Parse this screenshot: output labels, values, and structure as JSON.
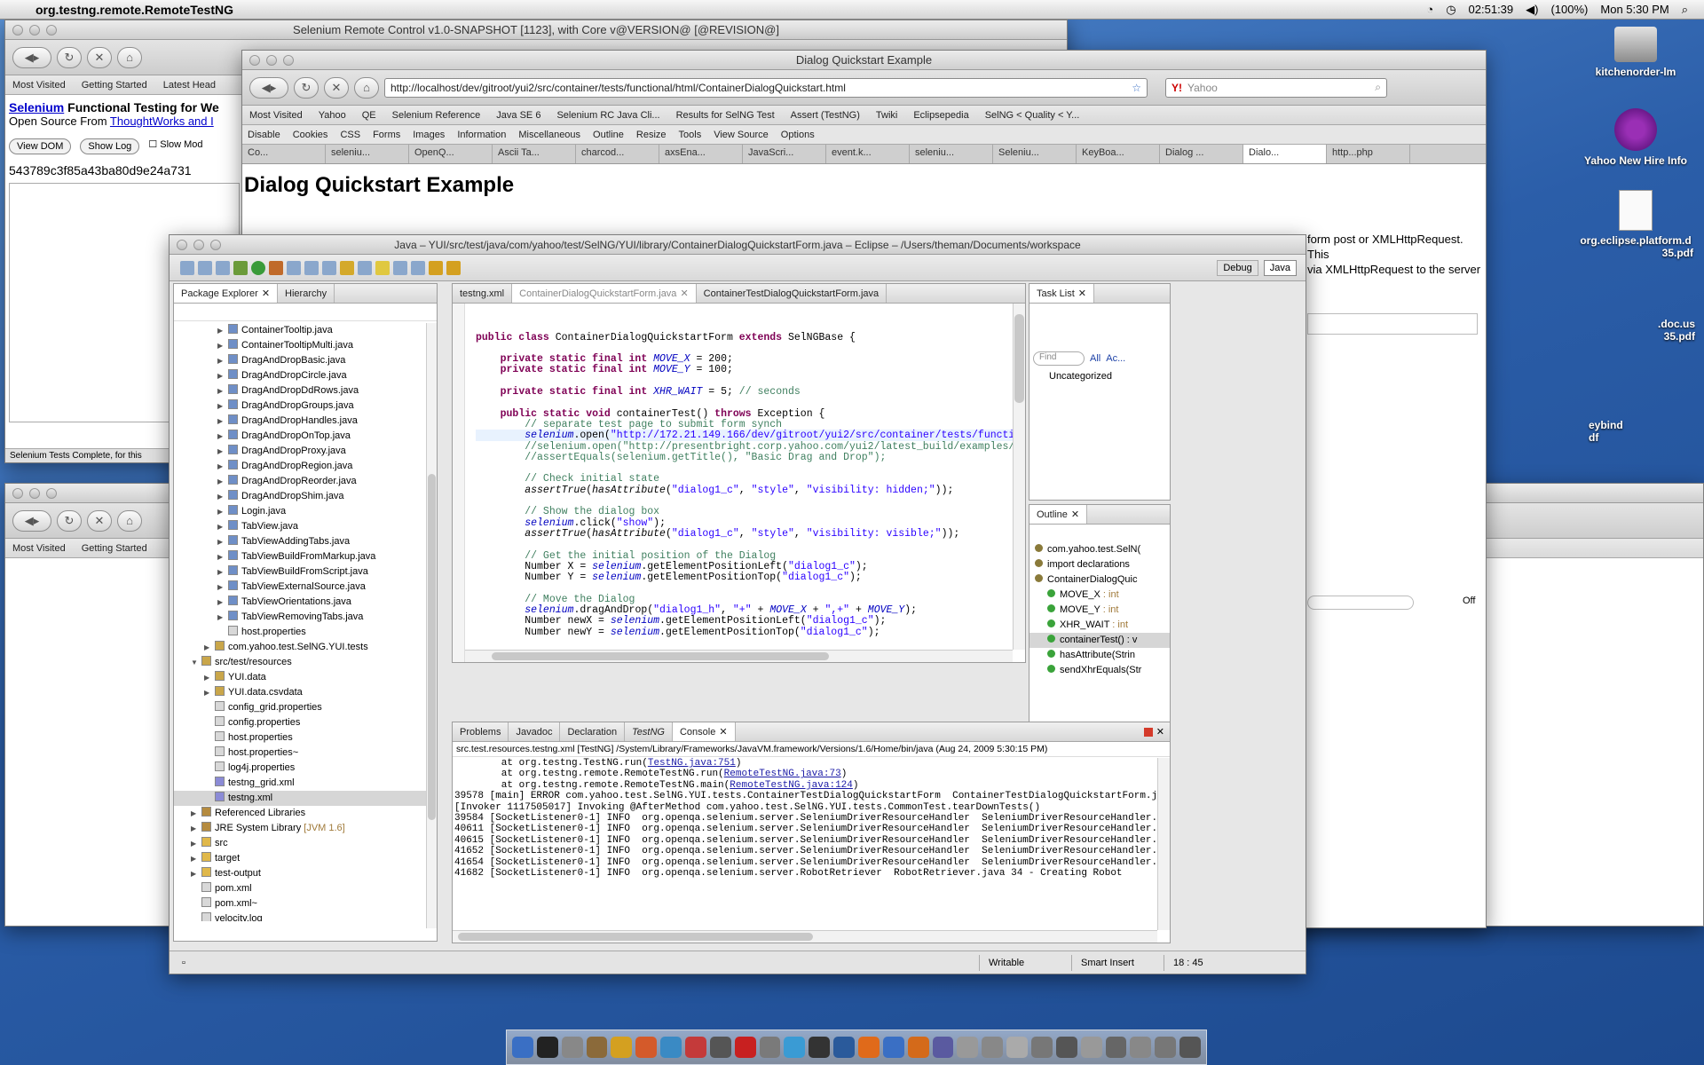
{
  "menubar": {
    "app": "org.testng.remote.RemoteTestNG",
    "time": "02:51:39",
    "battery": "(100%)",
    "clock": "Mon 5:30 PM"
  },
  "desktop": {
    "icons": [
      "kitchenorder-lm",
      "Yahoo New Hire Info",
      "org.eclipse.platform.d",
      "35.pdf",
      ".doc.us",
      "35.pdf",
      "eybind",
      "df"
    ]
  },
  "selenium_window": {
    "title": "Selenium Remote Control v1.0-SNAPSHOT [1123], with Core v@VERSION@ [@REVISION@]",
    "bookmarks": [
      "Most Visited",
      "Getting Started",
      "Latest Head"
    ],
    "heading_link": "Selenium",
    "heading_rest": " Functional Testing for We",
    "subtitle": "Open Source From ",
    "subtitle_link": "ThoughtWorks and I",
    "buttons": {
      "view_dom": "View DOM",
      "show_log": "Show Log",
      "slow_mode": "Slow Mod"
    },
    "session": "543789c3f85a43ba80d9e24a731",
    "status": "Selenium Tests Complete, for this"
  },
  "second_window": {
    "bookmarks": [
      "Most Visited",
      "Getting Started"
    ]
  },
  "firefox": {
    "title": "Dialog Quickstart Example",
    "url": "http://localhost/dev/gitroot/yui2/src/container/tests/functional/html/ContainerDialogQuickstart.html",
    "search": "Yahoo",
    "bookmarks": [
      "Most Visited",
      "Yahoo",
      "QE",
      "Selenium Reference",
      "Java SE 6",
      "Selenium RC Java Cli...",
      "Results for SelNG Test",
      "Assert (TestNG)",
      "Twiki",
      "Eclipsepedia",
      "SelNG < Quality < Y..."
    ],
    "webdev": [
      "Disable",
      "Cookies",
      "CSS",
      "Forms",
      "Images",
      "Information",
      "Miscellaneous",
      "Outline",
      "Resize",
      "Tools",
      "View Source",
      "Options"
    ],
    "tabs": [
      "Co...",
      "seleniu...",
      "OpenQ...",
      "Ascii Ta...",
      "charcod...",
      "axsEna...",
      "JavaScri...",
      "event.k...",
      "seleniu...",
      "Seleniu...",
      "KeyBoa...",
      "Dialog ...",
      "Dialo...",
      "http...php"
    ],
    "page_heading": "Dialog Quickstart Example",
    "page_text_1": "form post or XMLHttpRequest. This",
    "page_text_2": "via XMLHttpRequest to the server",
    "off": "Off"
  },
  "eclipse": {
    "title": "Java – YUI/src/test/java/com/yahoo/test/SelNG/YUI/library/ContainerDialogQuickstartForm.java – Eclipse – /Users/theman/Documents/workspace",
    "perspectives": [
      "Debug",
      "Java"
    ],
    "explorer_tabs": [
      "Package Explorer",
      "Hierarchy"
    ],
    "tree": [
      {
        "t": "ContainerTooltip.java",
        "d": 3,
        "ic": "j"
      },
      {
        "t": "ContainerTooltipMulti.java",
        "d": 3,
        "ic": "j"
      },
      {
        "t": "DragAndDropBasic.java",
        "d": 3,
        "ic": "j"
      },
      {
        "t": "DragAndDropCircle.java",
        "d": 3,
        "ic": "j"
      },
      {
        "t": "DragAndDropDdRows.java",
        "d": 3,
        "ic": "j"
      },
      {
        "t": "DragAndDropGroups.java",
        "d": 3,
        "ic": "j"
      },
      {
        "t": "DragAndDropHandles.java",
        "d": 3,
        "ic": "j"
      },
      {
        "t": "DragAndDropOnTop.java",
        "d": 3,
        "ic": "j"
      },
      {
        "t": "DragAndDropProxy.java",
        "d": 3,
        "ic": "j"
      },
      {
        "t": "DragAndDropRegion.java",
        "d": 3,
        "ic": "j"
      },
      {
        "t": "DragAndDropReorder.java",
        "d": 3,
        "ic": "j"
      },
      {
        "t": "DragAndDropShim.java",
        "d": 3,
        "ic": "j"
      },
      {
        "t": "Login.java",
        "d": 3,
        "ic": "j"
      },
      {
        "t": "TabView.java",
        "d": 3,
        "ic": "j"
      },
      {
        "t": "TabViewAddingTabs.java",
        "d": 3,
        "ic": "j"
      },
      {
        "t": "TabViewBuildFromMarkup.java",
        "d": 3,
        "ic": "j"
      },
      {
        "t": "TabViewBuildFromScript.java",
        "d": 3,
        "ic": "j"
      },
      {
        "t": "TabViewExternalSource.java",
        "d": 3,
        "ic": "j"
      },
      {
        "t": "TabViewOrientations.java",
        "d": 3,
        "ic": "j"
      },
      {
        "t": "TabViewRemovingTabs.java",
        "d": 3,
        "ic": "j"
      },
      {
        "t": "host.properties",
        "d": 3,
        "ic": "f"
      },
      {
        "t": "com.yahoo.test.SelNG.YUI.tests",
        "d": 2,
        "ic": "p"
      },
      {
        "t": "src/test/resources",
        "d": 1,
        "ic": "p",
        "open": true
      },
      {
        "t": "YUI.data",
        "d": 2,
        "ic": "p"
      },
      {
        "t": "YUI.data.csvdata",
        "d": 2,
        "ic": "p"
      },
      {
        "t": "config_grid.properties",
        "d": 2,
        "ic": "f"
      },
      {
        "t": "config.properties",
        "d": 2,
        "ic": "f"
      },
      {
        "t": "host.properties",
        "d": 2,
        "ic": "f"
      },
      {
        "t": "host.properties~",
        "d": 2,
        "ic": "f"
      },
      {
        "t": "log4j.properties",
        "d": 2,
        "ic": "f"
      },
      {
        "t": "testng_grid.xml",
        "d": 2,
        "ic": "x"
      },
      {
        "t": "testng.xml",
        "d": 2,
        "ic": "x",
        "sel": true
      },
      {
        "t": "Referenced Libraries",
        "d": 1,
        "ic": "l"
      },
      {
        "t": "JRE System Library",
        "extra": " [JVM 1.6]",
        "d": 1,
        "ic": "l"
      },
      {
        "t": "src",
        "d": 1,
        "ic": "d"
      },
      {
        "t": "target",
        "d": 1,
        "ic": "d"
      },
      {
        "t": "test-output",
        "d": 1,
        "ic": "d"
      },
      {
        "t": "pom.xml",
        "d": 1,
        "ic": "f"
      },
      {
        "t": "pom.xml~",
        "d": 1,
        "ic": "f"
      },
      {
        "t": "velocity.log",
        "d": 1,
        "ic": "f"
      }
    ],
    "editor_tabs": [
      "testng.xml",
      "ContainerDialogQuickstartForm.java",
      "ContainerTestDialogQuickstartForm.java"
    ],
    "task_tab": "Task List",
    "find_placeholder": "Find",
    "task_filters": [
      "All",
      "Ac..."
    ],
    "task_category": "Uncategorized",
    "outline_tab": "Outline",
    "outline": [
      {
        "t": "com.yahoo.test.SelN(",
        "d": 0
      },
      {
        "t": "import declarations",
        "d": 0
      },
      {
        "t": "ContainerDialogQuic",
        "d": 0
      },
      {
        "t": "MOVE_X",
        "s": " : int",
        "d": 1
      },
      {
        "t": "MOVE_Y",
        "s": " : int",
        "d": 1
      },
      {
        "t": "XHR_WAIT",
        "s": " : int",
        "d": 1
      },
      {
        "t": "containerTest() : v",
        "d": 1,
        "sel": true
      },
      {
        "t": "hasAttribute(Strin",
        "d": 1
      },
      {
        "t": "sendXhrEquals(Str",
        "d": 1
      }
    ],
    "console_tabs": [
      "Problems",
      "Javadoc",
      "Declaration",
      "TestNG",
      "Console"
    ],
    "console_header": "src.test.resources.testng.xml [TestNG] /System/Library/Frameworks/JavaVM.framework/Versions/1.6/Home/bin/java (Aug 24, 2009 5:30:15 PM)",
    "console_lines": [
      [
        "        at org.testng.TestNG.run(",
        "TestNG.java:751",
        ")"
      ],
      [
        "        at org.testng.remote.RemoteTestNG.run(",
        "RemoteTestNG.java:73",
        ")"
      ],
      [
        "        at org.testng.remote.RemoteTestNG.main(",
        "RemoteTestNG.java:124",
        ")"
      ],
      [
        "39578 [main] ERROR com.yahoo.test.SelNG.YUI.tests.ContainerTestDialogQuickstartForm  ContainerTestDialogQuickstartForm.java 22 - java.",
        "",
        ""
      ],
      [
        "[Invoker 1117505017] Invoking @AfterMethod com.yahoo.test.SelNG.YUI.tests.CommonTest.tearDownTests()",
        "",
        ""
      ],
      [
        "39584 [SocketListener0-1] INFO  org.openqa.selenium.server.SeleniumDriverResourceHandler  SeleniumDriverResourceHandler.java 384 - Com",
        "",
        ""
      ],
      [
        "40611 [SocketListener0-1] INFO  org.openqa.selenium.server.SeleniumDriverResourceHandler  SeleniumDriverResourceHandler.java 527 - Got",
        "",
        ""
      ],
      [
        "40615 [SocketListener0-1] INFO  org.openqa.selenium.server.SeleniumDriverResourceHandler  SeleniumDriverResourceHandler.java 384 - Com",
        "",
        ""
      ],
      [
        "41652 [SocketListener0-1] INFO  org.openqa.selenium.server.SeleniumDriverResourceHandler  SeleniumDriverResourceHandler.java 527 - Got",
        "",
        ""
      ],
      [
        "41654 [SocketListener0-1] INFO  org.openqa.selenium.server.SeleniumDriverResourceHandler  SeleniumDriverResourceHandler.java 384 - Com",
        "",
        ""
      ],
      [
        "41682 [SocketListener0-1] INFO  org.openqa.selenium.server.RobotRetriever  RobotRetriever.java 34 - Creating Robot",
        "",
        ""
      ]
    ],
    "status": {
      "writable": "Writable",
      "insert": "Smart Insert",
      "pos": "18 : 45"
    }
  }
}
